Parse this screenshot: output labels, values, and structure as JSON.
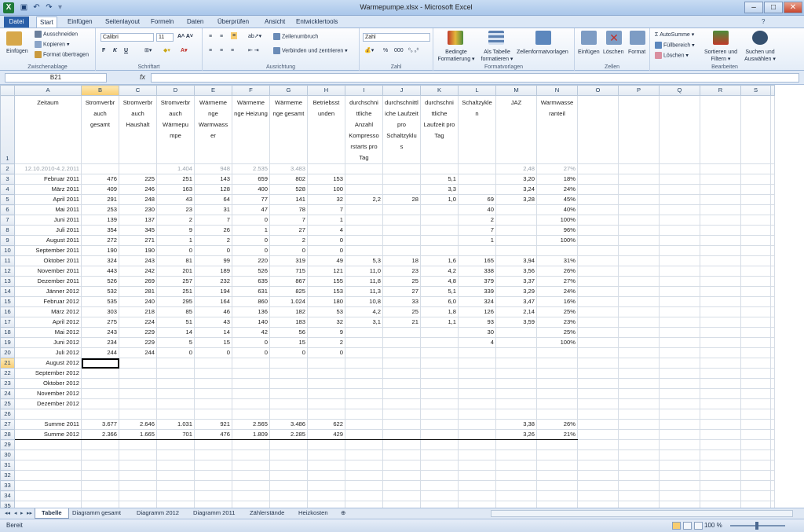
{
  "titlebar": {
    "title": "Warmepumpe.xlsx - Microsoft Excel",
    "app_icon": "X"
  },
  "tabs": [
    "Datei",
    "Start",
    "Einfügen",
    "Seitenlayout",
    "Formeln",
    "Daten",
    "Überprüfen",
    "Ansicht",
    "Entwicklertools"
  ],
  "ribbon": {
    "clipboard": {
      "paste": "Einfügen",
      "cut": "Ausschneiden",
      "copy": "Kopieren ▾",
      "format_painter": "Format übertragen",
      "label": "Zwischenablage"
    },
    "font": {
      "name": "Calibri",
      "size": "11",
      "bold": "F",
      "italic": "K",
      "underline": "U",
      "label": "Schriftart"
    },
    "alignment": {
      "wrap": "Zeilenumbruch",
      "merge": "Verbinden und zentrieren ▾",
      "label": "Ausrichtung"
    },
    "number": {
      "format": "Zahl",
      "percent": "%",
      "thousands": "000",
      "label": "Zahl"
    },
    "styles": {
      "conditional": "Bedingte Formatierung ▾",
      "as_table": "Als Tabelle formatieren ▾",
      "cell_styles": "Zellenformatvorlagen",
      "label": "Formatvorlagen"
    },
    "cells": {
      "insert": "Einfügen",
      "delete": "Löschen",
      "format": "Format",
      "label": "Zellen"
    },
    "editing": {
      "autosum": "Σ AutoSumme ▾",
      "fill": "Füllbereich ▾",
      "clear": "Löschen ▾",
      "sort": "Sortieren und Filtern ▾",
      "find": "Suchen und Auswählen ▾",
      "label": "Bearbeiten"
    }
  },
  "formula_bar": {
    "namebox": "B21",
    "fx": "fx",
    "value": ""
  },
  "columns": [
    "A",
    "B",
    "C",
    "D",
    "E",
    "F",
    "G",
    "H",
    "I",
    "J",
    "K",
    "L",
    "M",
    "N",
    "O",
    "P",
    "Q",
    "R",
    "S"
  ],
  "header_row": [
    "Zeitaum",
    "Stromverbr auch gesamt",
    "Stromverbr auch Haushalt",
    "Stromverbr auch Wärmepu mpe",
    "Wärmeme nge Warmwass er",
    "Wärmeme nge Heizung",
    "Wärmeme nge gesamt",
    "Betriebsst unden",
    "durchschni ttliche Anzahl Kompresso rstarts pro Tag",
    "durchschnittl iche Laufzeit pro Schaltzyklu s",
    "durchschni ttliche Laufzeit pro Tag",
    "Schaltzykle n",
    "JAZ",
    "Warmwasse ranteil",
    "",
    "",
    "",
    "",
    ""
  ],
  "rows": [
    {
      "n": "2",
      "style": "grey",
      "c": [
        "12.10.2010-4.2.2011",
        "",
        "",
        "1.404",
        "948",
        "2.535",
        "3.483",
        "",
        "",
        "",
        "",
        "",
        "2,48",
        "27%",
        "",
        "",
        "",
        "",
        ""
      ]
    },
    {
      "n": "3",
      "c": [
        "Februar 2011",
        "476",
        "225",
        "251",
        "143",
        "659",
        "802",
        "153",
        "",
        "",
        "5,1",
        "",
        "3,20",
        "18%",
        "",
        "",
        "",
        "",
        ""
      ]
    },
    {
      "n": "4",
      "c": [
        "März 2011",
        "409",
        "246",
        "163",
        "128",
        "400",
        "528",
        "100",
        "",
        "",
        "3,3",
        "",
        "3,24",
        "24%",
        "",
        "",
        "",
        "",
        ""
      ]
    },
    {
      "n": "5",
      "c": [
        "April 2011",
        "291",
        "248",
        "43",
        "64",
        "77",
        "141",
        "32",
        "2,2",
        "28",
        "1,0",
        "69",
        "3,28",
        "45%",
        "",
        "",
        "",
        "",
        ""
      ]
    },
    {
      "n": "6",
      "c": [
        "Mai 2011",
        "253",
        "230",
        "23",
        "31",
        "47",
        "78",
        "7",
        "",
        "",
        "",
        "40",
        "",
        "40%",
        "",
        "",
        "",
        "",
        ""
      ]
    },
    {
      "n": "7",
      "c": [
        "Juni 2011",
        "139",
        "137",
        "2",
        "7",
        "0",
        "7",
        "1",
        "",
        "",
        "",
        "2",
        "",
        "100%",
        "",
        "",
        "",
        "",
        ""
      ]
    },
    {
      "n": "8",
      "c": [
        "Juli 2011",
        "354",
        "345",
        "9",
        "26",
        "1",
        "27",
        "4",
        "",
        "",
        "",
        "7",
        "",
        "96%",
        "",
        "",
        "",
        "",
        ""
      ]
    },
    {
      "n": "9",
      "c": [
        "August 2011",
        "272",
        "271",
        "1",
        "2",
        "0",
        "2",
        "0",
        "",
        "",
        "",
        "1",
        "",
        "100%",
        "",
        "",
        "",
        "",
        ""
      ]
    },
    {
      "n": "10",
      "c": [
        "September 2011",
        "190",
        "190",
        "0",
        "0",
        "0",
        "0",
        "0",
        "",
        "",
        "",
        "",
        "",
        "",
        "",
        "",
        "",
        "",
        ""
      ]
    },
    {
      "n": "11",
      "c": [
        "Oktober 2011",
        "324",
        "243",
        "81",
        "99",
        "220",
        "319",
        "49",
        "5,3",
        "18",
        "1,6",
        "165",
        "3,94",
        "31%",
        "",
        "",
        "",
        "",
        ""
      ]
    },
    {
      "n": "12",
      "c": [
        "November 2011",
        "443",
        "242",
        "201",
        "189",
        "526",
        "715",
        "121",
        "11,0",
        "23",
        "4,2",
        "338",
        "3,56",
        "26%",
        "",
        "",
        "",
        "",
        ""
      ]
    },
    {
      "n": "13",
      "c": [
        "Dezember 2011",
        "526",
        "269",
        "257",
        "232",
        "635",
        "867",
        "155",
        "11,8",
        "25",
        "4,8",
        "379",
        "3,37",
        "27%",
        "",
        "",
        "",
        "",
        ""
      ]
    },
    {
      "n": "14",
      "c": [
        "Jänner 2012",
        "532",
        "281",
        "251",
        "194",
        "631",
        "825",
        "153",
        "11,3",
        "27",
        "5,1",
        "339",
        "3,29",
        "24%",
        "",
        "",
        "",
        "",
        ""
      ]
    },
    {
      "n": "15",
      "c": [
        "Februar 2012",
        "535",
        "240",
        "295",
        "164",
        "860",
        "1.024",
        "180",
        "10,8",
        "33",
        "6,0",
        "324",
        "3,47",
        "16%",
        "",
        "",
        "",
        "",
        ""
      ]
    },
    {
      "n": "16",
      "c": [
        "März 2012",
        "303",
        "218",
        "85",
        "46",
        "136",
        "182",
        "53",
        "4,2",
        "25",
        "1,8",
        "126",
        "2,14",
        "25%",
        "",
        "",
        "",
        "",
        ""
      ]
    },
    {
      "n": "17",
      "c": [
        "April 2012",
        "275",
        "224",
        "51",
        "43",
        "140",
        "183",
        "32",
        "3,1",
        "21",
        "1,1",
        "93",
        "3,59",
        "23%",
        "",
        "",
        "",
        "",
        ""
      ]
    },
    {
      "n": "18",
      "c": [
        "Mai 2012",
        "243",
        "229",
        "14",
        "14",
        "42",
        "56",
        "9",
        "",
        "",
        "",
        "30",
        "",
        "25%",
        "",
        "",
        "",
        "",
        ""
      ]
    },
    {
      "n": "19",
      "c": [
        "Juni 2012",
        "234",
        "229",
        "5",
        "15",
        "0",
        "15",
        "2",
        "",
        "",
        "",
        "4",
        "",
        "100%",
        "",
        "",
        "",
        "",
        ""
      ]
    },
    {
      "n": "20",
      "c": [
        "Juli 2012",
        "244",
        "244",
        "0",
        "0",
        "0",
        "0",
        "0",
        "",
        "",
        "",
        "",
        "",
        "",
        "",
        "",
        "",
        "",
        ""
      ]
    },
    {
      "n": "21",
      "c": [
        "August 2012",
        "",
        "",
        "",
        "",
        "",
        "",
        "",
        "",
        "",
        "",
        "",
        "",
        "",
        "",
        "",
        "",
        "",
        ""
      ]
    },
    {
      "n": "22",
      "c": [
        "September 2012",
        "",
        "",
        "",
        "",
        "",
        "",
        "",
        "",
        "",
        "",
        "",
        "",
        "",
        "",
        "",
        "",
        "",
        ""
      ]
    },
    {
      "n": "23",
      "c": [
        "Oktober 2012",
        "",
        "",
        "",
        "",
        "",
        "",
        "",
        "",
        "",
        "",
        "",
        "",
        "",
        "",
        "",
        "",
        "",
        ""
      ]
    },
    {
      "n": "24",
      "c": [
        "November 2012",
        "",
        "",
        "",
        "",
        "",
        "",
        "",
        "",
        "",
        "",
        "",
        "",
        "",
        "",
        "",
        "",
        "",
        ""
      ]
    },
    {
      "n": "25",
      "c": [
        "Dezember 2012",
        "",
        "",
        "",
        "",
        "",
        "",
        "",
        "",
        "",
        "",
        "",
        "",
        "",
        "",
        "",
        "",
        "",
        ""
      ]
    },
    {
      "n": "26",
      "c": [
        "",
        "",
        "",
        "",
        "",
        "",
        "",
        "",
        "",
        "",
        "",
        "",
        "",
        "",
        "",
        "",
        "",
        "",
        ""
      ]
    },
    {
      "n": "27",
      "style": "sum",
      "c": [
        "Summe 2011",
        "3.677",
        "2.646",
        "1.031",
        "921",
        "2.565",
        "3.486",
        "622",
        "",
        "",
        "",
        "",
        "3,38",
        "26%",
        "",
        "",
        "",
        "",
        ""
      ]
    },
    {
      "n": "28",
      "style": "sum",
      "c": [
        "Summe 2012",
        "2.366",
        "1.665",
        "701",
        "476",
        "1.809",
        "2.285",
        "429",
        "",
        "",
        "",
        "",
        "3,26",
        "21%",
        "",
        "",
        "",
        "",
        ""
      ]
    },
    {
      "n": "29",
      "c": [
        "",
        "",
        "",
        "",
        "",
        "",
        "",
        "",
        "",
        "",
        "",
        "",
        "",
        "",
        "",
        "",
        "",
        "",
        ""
      ]
    },
    {
      "n": "30",
      "c": [
        "",
        "",
        "",
        "",
        "",
        "",
        "",
        "",
        "",
        "",
        "",
        "",
        "",
        "",
        "",
        "",
        "",
        "",
        ""
      ]
    },
    {
      "n": "31",
      "c": [
        "",
        "",
        "",
        "",
        "",
        "",
        "",
        "",
        "",
        "",
        "",
        "",
        "",
        "",
        "",
        "",
        "",
        "",
        ""
      ]
    },
    {
      "n": "32",
      "c": [
        "",
        "",
        "",
        "",
        "",
        "",
        "",
        "",
        "",
        "",
        "",
        "",
        "",
        "",
        "",
        "",
        "",
        "",
        ""
      ]
    },
    {
      "n": "33",
      "c": [
        "",
        "",
        "",
        "",
        "",
        "",
        "",
        "",
        "",
        "",
        "",
        "",
        "",
        "",
        "",
        "",
        "",
        "",
        ""
      ]
    },
    {
      "n": "34",
      "c": [
        "",
        "",
        "",
        "",
        "",
        "",
        "",
        "",
        "",
        "",
        "",
        "",
        "",
        "",
        "",
        "",
        "",
        "",
        ""
      ]
    },
    {
      "n": "35",
      "c": [
        "",
        "",
        "",
        "",
        "",
        "",
        "",
        "",
        "",
        "",
        "",
        "",
        "",
        "",
        "",
        "",
        "",
        "",
        ""
      ]
    }
  ],
  "sheet_tabs": [
    "Tabelle",
    "Diagramm gesamt",
    "Diagramm 2012",
    "Diagramm 2011",
    "Zählerstände",
    "Heizkosten"
  ],
  "status": {
    "ready": "Bereit",
    "zoom": "100 %"
  }
}
